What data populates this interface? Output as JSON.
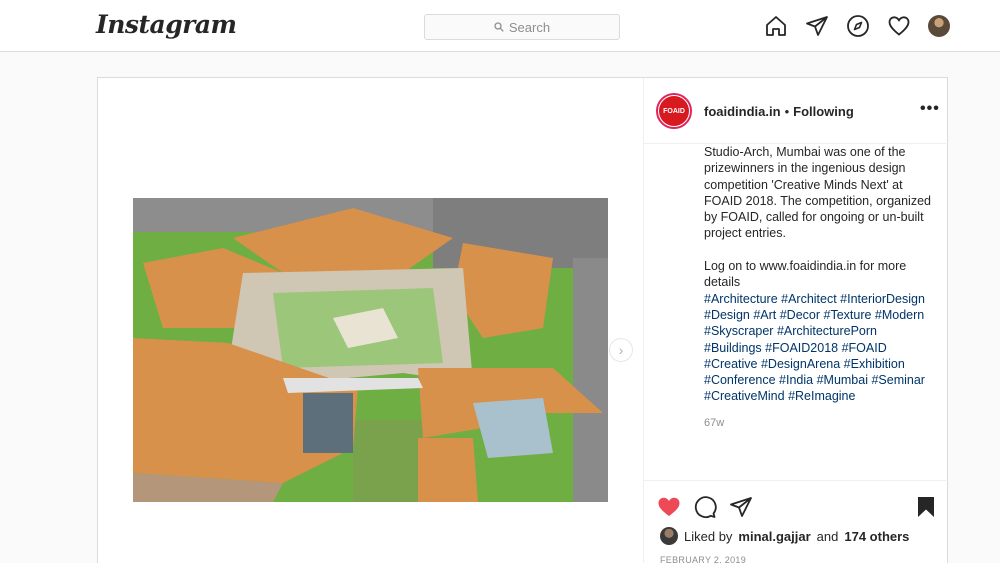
{
  "header": {
    "logo": "Instagram",
    "search_placeholder": "Search",
    "icons": [
      "home-icon",
      "direct-icon",
      "explore-icon",
      "activity-heart-icon",
      "profile-avatar"
    ]
  },
  "post": {
    "username": "foaidindia.in",
    "separator": "•",
    "follow_status": "Following",
    "avatar_text": "FOAID",
    "more_label": "•••",
    "caption_text": "Studio-Arch, Mumbai was one of the prizewinners in the ingenious design competition 'Creative Minds Next' at FOAID 2018. The competition, organized by FOAID, called for ongoing or un-built project entries.\n\nLog on to www.foaidindia.in for more details",
    "hashtags": "#Architecture #Architect #InteriorDesign #Design #Art #Decor #Texture #Modern #Skyscraper #ArchitecturePorn #Buildings #FOAID2018 #FOAID #Creative #DesignArena #Exhibition #Conference #India #Mumbai #Seminar #CreativeMind #ReImagine",
    "caption_age": "67w",
    "liked_prefix": "Liked by",
    "liked_user": "minal.gajjar",
    "liked_and": "and",
    "liked_others": "174 others",
    "date": "FEBRUARY 2, 2019",
    "next_arrow": "›"
  },
  "colors": {
    "like_red": "#ed4956",
    "hashtag_blue": "#003569",
    "roof_orange": "#d8914a",
    "grass_green": "#6fae43"
  }
}
